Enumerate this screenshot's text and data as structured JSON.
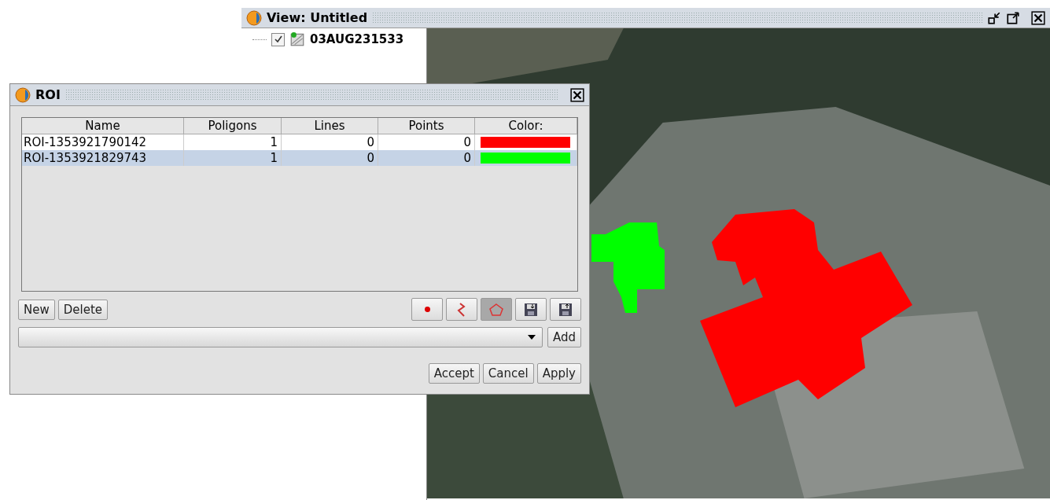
{
  "view": {
    "title": "View: Untitled",
    "layers": [
      {
        "label": "03AUG231533",
        "checked": true
      }
    ]
  },
  "roi_dialog": {
    "title": "ROI",
    "table": {
      "columns": [
        "Name",
        "Poligons",
        "Lines",
        "Points",
        "Color:"
      ],
      "rows": [
        {
          "name": "ROI-1353921790142",
          "poligons": "1",
          "lines": "0",
          "points": "0",
          "color": "#ff0000",
          "selected": false
        },
        {
          "name": "ROI-1353921829743",
          "poligons": "1",
          "lines": "0",
          "points": "0",
          "color": "#00ff00",
          "selected": true
        }
      ]
    },
    "buttons": [
      "New",
      "Delete"
    ],
    "tools": [
      {
        "kind": "point",
        "selected": false
      },
      {
        "kind": "line",
        "selected": false
      },
      {
        "kind": "polygon",
        "selected": true
      },
      {
        "kind": "save",
        "selected": false
      },
      {
        "kind": "load",
        "selected": false
      }
    ],
    "add_button": "Add",
    "footer_buttons": [
      "Accept",
      "Cancel",
      "Apply"
    ]
  }
}
